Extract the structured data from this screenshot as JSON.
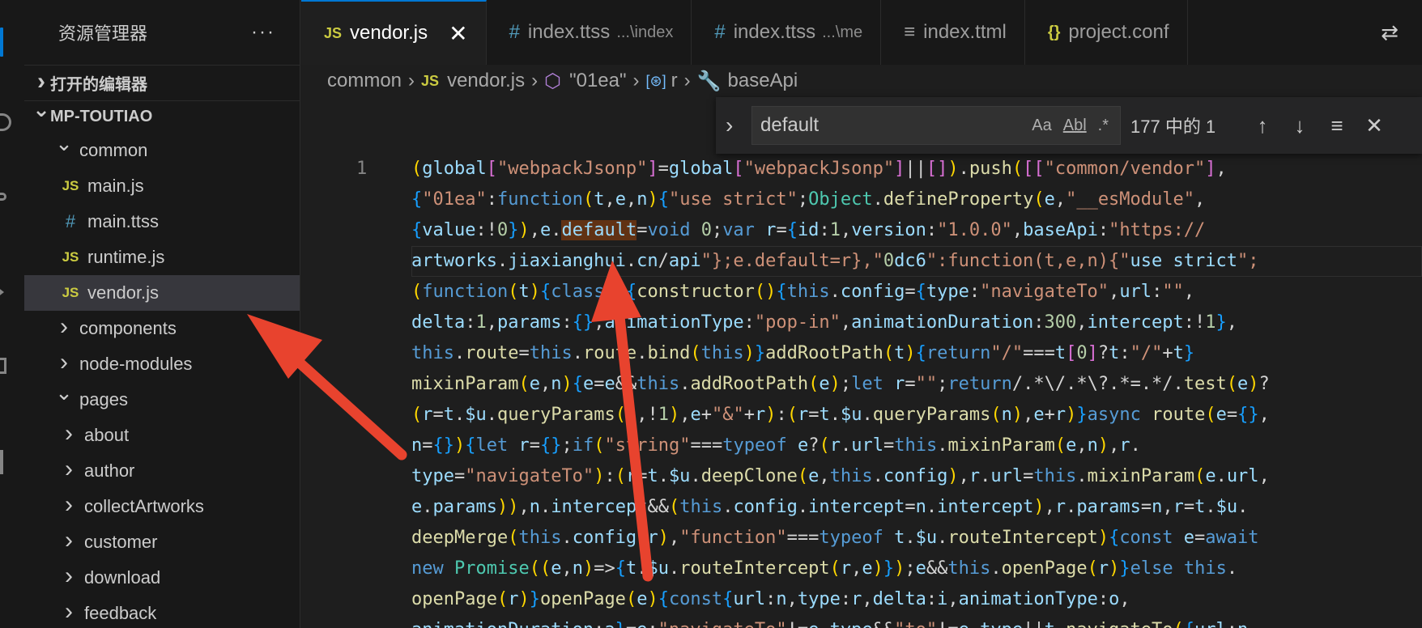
{
  "sidebar": {
    "title": "资源管理器",
    "more": "···",
    "open_editors": "打开的编辑器",
    "project": "MP-TOUTIAO",
    "tree": [
      {
        "label": "common",
        "icon": "folder-open",
        "depth": 1,
        "expanded": true
      },
      {
        "label": "main.js",
        "icon": "js-icon",
        "depth": 2
      },
      {
        "label": "main.ttss",
        "icon": "css-icon",
        "depth": 2
      },
      {
        "label": "runtime.js",
        "icon": "js-icon",
        "depth": 2
      },
      {
        "label": "vendor.js",
        "icon": "js-icon",
        "depth": 2,
        "selected": true
      },
      {
        "label": "components",
        "icon": "folder",
        "depth": 1
      },
      {
        "label": "node-modules",
        "icon": "folder",
        "depth": 1
      },
      {
        "label": "pages",
        "icon": "folder-open",
        "depth": 1,
        "expanded": true
      },
      {
        "label": "about",
        "icon": "folder",
        "depth": 2
      },
      {
        "label": "author",
        "icon": "folder",
        "depth": 2
      },
      {
        "label": "collectArtworks",
        "icon": "folder",
        "depth": 2
      },
      {
        "label": "customer",
        "icon": "folder",
        "depth": 2
      },
      {
        "label": "download",
        "icon": "folder",
        "depth": 2
      },
      {
        "label": "feedback",
        "icon": "folder",
        "depth": 2
      }
    ]
  },
  "tabs": [
    {
      "icon": "JS",
      "label": "vendor.js",
      "sub": "",
      "active": true
    },
    {
      "icon": "#",
      "label": "index.ttss",
      "sub": "...\\index"
    },
    {
      "icon": "#",
      "label": "index.ttss",
      "sub": "...\\me"
    },
    {
      "icon": "≡",
      "label": "index.ttml",
      "sub": ""
    },
    {
      "icon": "{}",
      "label": "project.conf",
      "sub": ""
    }
  ],
  "breadcrumb": {
    "folder": "common",
    "file_icon": "JS",
    "file": "vendor.js",
    "module": "\"01ea\"",
    "var": "r",
    "prop": "baseApi"
  },
  "find": {
    "value": "default",
    "match_case": "Aa",
    "whole_word": "Abl",
    "regex": ".*",
    "count": "177 中的 1",
    "prev": "↑",
    "next": "↓",
    "selection": "≡",
    "close": "✕"
  },
  "editor": {
    "line_number": "1",
    "lines": [
      "(global[\"webpackJsonp\"]=global[\"webpackJsonp\"]||[]).push([[\"common/vendor\"],",
      "{\"01ea\":function(t,e,n){\"use strict\";Object.defineProperty(e,\"__esModule\",",
      "{value:!0}),e.default=void 0;var r={id:1,version:\"1.0.0\",baseApi:\"https://",
      "artworks.jiaxianghui.cn/api\"};e.default=r},\"0dc6\":function(t,e,n){\"use strict\";",
      "(function(t){class n{constructor(){this.config={type:\"navigateTo\",url:\"\",",
      "delta:1,params:{},animationType:\"pop-in\",animationDuration:300,intercept:!1},",
      "this.route=this.route.bind(this)}addRootPath(t){return\"/\"===t[0]?t:\"/\"+t}",
      "mixinParam(e,n){e=e&&this.addRootPath(e);let r=\"\";return/.*\\/.*\\?.*=.*/.test(e)?",
      "(r=t.$u.queryParams(n,!1),e+\"&\"+r):(r=t.$u.queryParams(n),e+r)}async route(e={},",
      "n={}){let r={};if(\"string\"===typeof e?(r.url=this.mixinParam(e,n),r.",
      "type=\"navigateTo\"):(r=t.$u.deepClone(e,this.config),r.url=this.mixinParam(e.url,",
      "e.params)),n.intercept&&(this.config.intercept=n.intercept),r.params=n,r=t.$u.",
      "deepMerge(this.config,r),\"function\"===typeof t.$u.routeIntercept){const e=await",
      "new Promise((e,n)=>{t.$u.routeIntercept(r,e)});e&&this.openPage(r)}else this.",
      "openPage(r)}openPage(e){const{url:n,type:r,delta:i,animationType:o,",
      "animationDuration:a}=e;\"navigateTo\"!=e.type&&\"to\"!=e.type||t.navigateTo({url:n,"
    ]
  },
  "colors": {
    "keyword": "#569cd6",
    "string": "#ce9178",
    "text": "#d4d4d4",
    "function": "#dcdcaa",
    "variable": "#9cdcfe",
    "type": "#4ec9b0",
    "bracket1": "#ffd700",
    "bracket2": "#da70d6",
    "bracket3": "#179fff",
    "number": "#b5cea8",
    "highlight": "#613214",
    "arrow": "#e8432e"
  }
}
